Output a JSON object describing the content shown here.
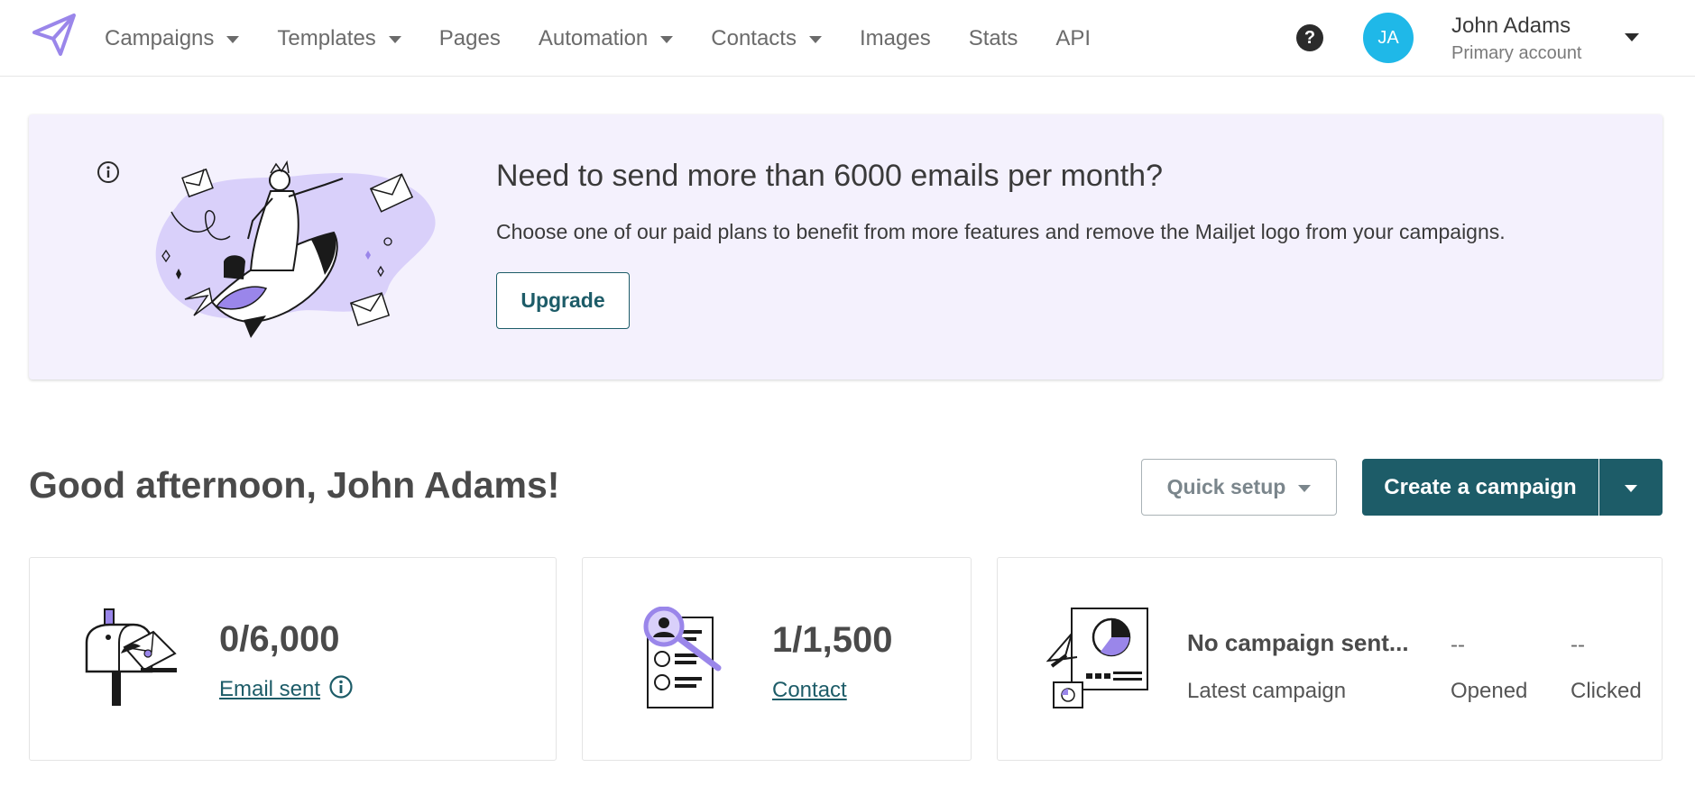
{
  "nav": {
    "items": [
      {
        "label": "Campaigns",
        "dropdown": true
      },
      {
        "label": "Templates",
        "dropdown": true
      },
      {
        "label": "Pages",
        "dropdown": false
      },
      {
        "label": "Automation",
        "dropdown": true
      },
      {
        "label": "Contacts",
        "dropdown": true
      },
      {
        "label": "Images",
        "dropdown": false
      },
      {
        "label": "Stats",
        "dropdown": false
      },
      {
        "label": "API",
        "dropdown": false
      }
    ]
  },
  "user": {
    "initials": "JA",
    "name": "John Adams",
    "account": "Primary account",
    "help_glyph": "?"
  },
  "banner": {
    "title": "Need to send more than 6000 emails per month?",
    "text": "Choose one of our paid plans to benefit from more features and remove the Mailjet logo from your campaigns.",
    "button": "Upgrade"
  },
  "greeting": "Good afternoon, John Adams!",
  "actions": {
    "quick_setup": "Quick setup",
    "create_campaign": "Create a campaign"
  },
  "cards": {
    "emails": {
      "value": "0/6,000",
      "label": "Email sent"
    },
    "contacts": {
      "value": "1/1,500",
      "label": "Contact"
    },
    "latest": {
      "title": "No campaign sent...",
      "label": "Latest campaign",
      "opened_value": "--",
      "opened_label": "Opened",
      "clicked_value": "--",
      "clicked_label": "Clicked"
    }
  },
  "colors": {
    "primary": "#1d5c68",
    "accent_purple": "#9a86ea",
    "banner_bg": "#f4f1fd",
    "avatar": "#1fb8e8"
  }
}
